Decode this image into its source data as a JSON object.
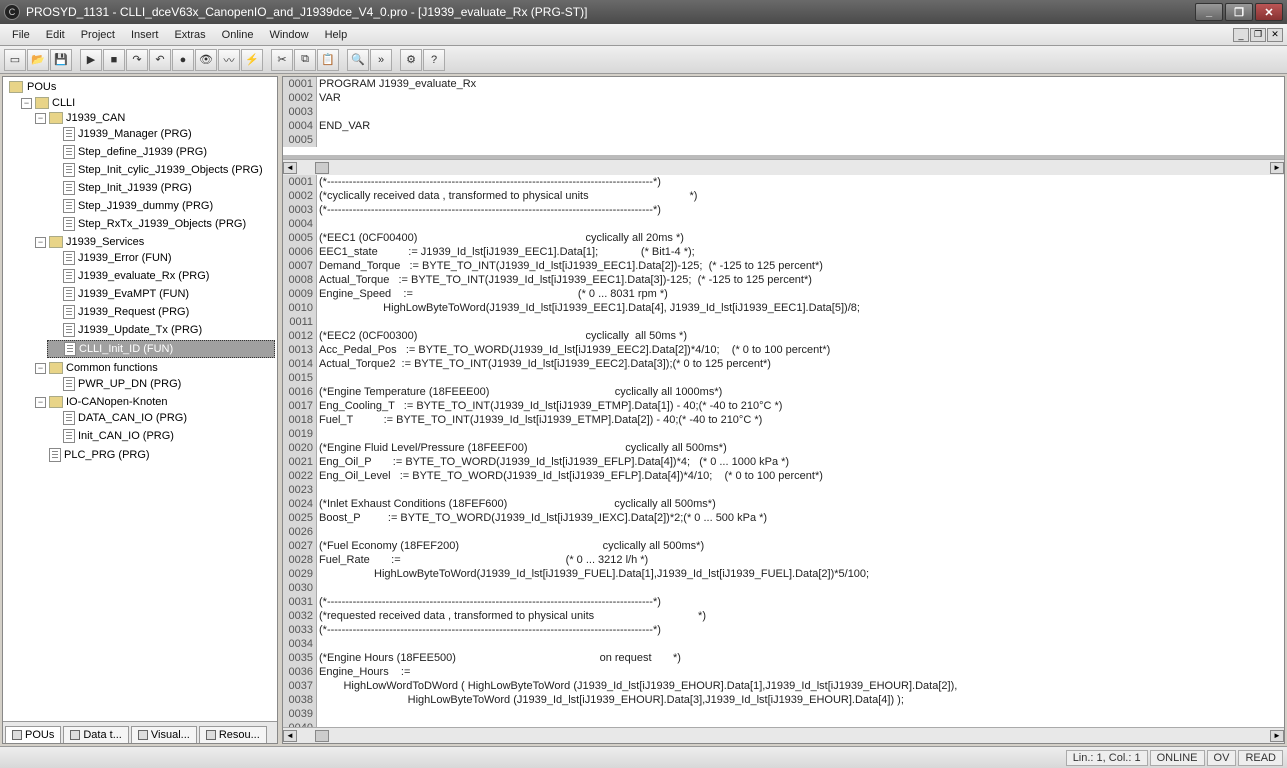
{
  "title": "PROSYD_1131 - CLLI_dceV63x_CanopenIO_and_J1939dce_V4_0.pro - [J1939_evaluate_Rx (PRG-ST)]",
  "menu": [
    "File",
    "Edit",
    "Project",
    "Insert",
    "Extras",
    "Online",
    "Window",
    "Help"
  ],
  "toolbar_icons": [
    "new",
    "open",
    "save",
    "|",
    "run",
    "stop",
    "step",
    "over",
    "bp",
    "watch",
    "trace",
    "force",
    "|",
    "cut",
    "copy",
    "paste",
    "|",
    "find",
    "next",
    "|",
    "cfg",
    "help"
  ],
  "tree": {
    "root": "POUs",
    "nodes": [
      {
        "label": "CLLI",
        "folder": true,
        "children": [
          {
            "label": "J1939_CAN",
            "folder": true,
            "children": [
              {
                "label": "J1939_Manager (PRG)"
              },
              {
                "label": "Step_define_J1939 (PRG)"
              },
              {
                "label": "Step_Init_cylic_J1939_Objects (PRG)"
              },
              {
                "label": "Step_Init_J1939 (PRG)"
              },
              {
                "label": "Step_J1939_dummy (PRG)"
              },
              {
                "label": "Step_RxTx_J1939_Objects (PRG)"
              }
            ]
          },
          {
            "label": "J1939_Services",
            "folder": true,
            "children": [
              {
                "label": "J1939_Error (FUN)"
              },
              {
                "label": "J1939_evaluate_Rx (PRG)"
              },
              {
                "label": "J1939_EvaMPT (FUN)"
              },
              {
                "label": "J1939_Request (PRG)"
              },
              {
                "label": "J1939_Update_Tx (PRG)"
              },
              {
                "label": "CLLI_Init_ID (FUN)",
                "selected": true
              }
            ]
          },
          {
            "label": "Common functions",
            "folder": true,
            "children": [
              {
                "label": "PWR_UP_DN (PRG)"
              }
            ]
          },
          {
            "label": "IO-CANopen-Knoten",
            "folder": true,
            "children": [
              {
                "label": "DATA_CAN_IO (PRG)"
              },
              {
                "label": "Init_CAN_IO (PRG)"
              }
            ]
          },
          {
            "label": "PLC_PRG (PRG)"
          }
        ]
      }
    ]
  },
  "tabs": [
    {
      "label": "POUs",
      "active": true
    },
    {
      "label": "Data t..."
    },
    {
      "label": "Visual..."
    },
    {
      "label": "Resou..."
    }
  ],
  "decl": [
    {
      "n": "0001",
      "t": "PROGRAM J1939_evaluate_Rx"
    },
    {
      "n": "0002",
      "t": "VAR"
    },
    {
      "n": "0003",
      "t": ""
    },
    {
      "n": "0004",
      "t": "END_VAR"
    },
    {
      "n": "0005",
      "t": ""
    }
  ],
  "body": [
    {
      "n": "0001",
      "t": "(*-----------------------------------------------------------------------------------------*)"
    },
    {
      "n": "0002",
      "t": "(*cyclically received data , transformed to physical units                                 *)"
    },
    {
      "n": "0003",
      "t": "(*-----------------------------------------------------------------------------------------*)"
    },
    {
      "n": "0004",
      "t": ""
    },
    {
      "n": "0005",
      "t": "(*EEC1 (0CF00400)                                                       cyclically all 20ms *)"
    },
    {
      "n": "0006",
      "t": "EEC1_state          := J1939_Id_lst[iJ1939_EEC1].Data[1];              (* Bit1-4 *);"
    },
    {
      "n": "0007",
      "t": "Demand_Torque   := BYTE_TO_INT(J1939_Id_lst[iJ1939_EEC1].Data[2])-125;  (* -125 to 125 percent*)"
    },
    {
      "n": "0008",
      "t": "Actual_Torque   := BYTE_TO_INT(J1939_Id_lst[iJ1939_EEC1].Data[3])-125;  (* -125 to 125 percent*)"
    },
    {
      "n": "0009",
      "t": "Engine_Speed    :=                                                      (* 0 ... 8031 rpm *)"
    },
    {
      "n": "0010",
      "t": "                     HighLowByteToWord(J1939_Id_lst[iJ1939_EEC1].Data[4], J1939_Id_lst[iJ1939_EEC1].Data[5])/8;"
    },
    {
      "n": "0011",
      "t": ""
    },
    {
      "n": "0012",
      "t": "(*EEC2 (0CF00300)                                                       cyclically  all 50ms *)"
    },
    {
      "n": "0013",
      "t": "Acc_Pedal_Pos   := BYTE_TO_WORD(J1939_Id_lst[iJ1939_EEC2].Data[2])*4/10;    (* 0 to 100 percent*)"
    },
    {
      "n": "0014",
      "t": "Actual_Torque2  := BYTE_TO_INT(J1939_Id_lst[iJ1939_EEC2].Data[3]);(* 0 to 125 percent*)"
    },
    {
      "n": "0015",
      "t": ""
    },
    {
      "n": "0016",
      "t": "(*Engine Temperature (18FEEE00)                                         cyclically all 1000ms*)"
    },
    {
      "n": "0017",
      "t": "Eng_Cooling_T   := BYTE_TO_INT(J1939_Id_lst[iJ1939_ETMP].Data[1]) - 40;(* -40 to 210°C *)"
    },
    {
      "n": "0018",
      "t": "Fuel_T          := BYTE_TO_INT(J1939_Id_lst[iJ1939_ETMP].Data[2]) - 40;(* -40 to 210°C *)"
    },
    {
      "n": "0019",
      "t": ""
    },
    {
      "n": "0020",
      "t": "(*Engine Fluid Level/Pressure (18FEEF00)                                cyclically all 500ms*)"
    },
    {
      "n": "0021",
      "t": "Eng_Oil_P       := BYTE_TO_WORD(J1939_Id_lst[iJ1939_EFLP].Data[4])*4;   (* 0 ... 1000 kPa *)"
    },
    {
      "n": "0022",
      "t": "Eng_Oil_Level   := BYTE_TO_WORD(J1939_Id_lst[iJ1939_EFLP].Data[4])*4/10;    (* 0 to 100 percent*)"
    },
    {
      "n": "0023",
      "t": ""
    },
    {
      "n": "0024",
      "t": "(*Inlet Exhaust Conditions (18FEF600)                                   cyclically all 500ms*)"
    },
    {
      "n": "0025",
      "t": "Boost_P         := BYTE_TO_WORD(J1939_Id_lst[iJ1939_IEXC].Data[2])*2;(* 0 ... 500 kPa *)"
    },
    {
      "n": "0026",
      "t": ""
    },
    {
      "n": "0027",
      "t": "(*Fuel Economy (18FEF200)                                               cyclically all 500ms*)"
    },
    {
      "n": "0028",
      "t": "Fuel_Rate       :=                                                      (* 0 ... 3212 l/h *)"
    },
    {
      "n": "0029",
      "t": "                  HighLowByteToWord(J1939_Id_lst[iJ1939_FUEL].Data[1],J1939_Id_lst[iJ1939_FUEL].Data[2])*5/100;"
    },
    {
      "n": "0030",
      "t": ""
    },
    {
      "n": "0031",
      "t": "(*-----------------------------------------------------------------------------------------*)"
    },
    {
      "n": "0032",
      "t": "(*requested received data , transformed to physical units                                  *)"
    },
    {
      "n": "0033",
      "t": "(*-----------------------------------------------------------------------------------------*)"
    },
    {
      "n": "0034",
      "t": ""
    },
    {
      "n": "0035",
      "t": "(*Engine Hours (18FEE500)                                               on request       *)"
    },
    {
      "n": "0036",
      "t": "Engine_Hours    :="
    },
    {
      "n": "0037",
      "t": "        HighLowWordToDWord ( HighLowByteToWord (J1939_Id_lst[iJ1939_EHOUR].Data[1],J1939_Id_lst[iJ1939_EHOUR].Data[2]),"
    },
    {
      "n": "0038",
      "t": "                             HighLowByteToWord (J1939_Id_lst[iJ1939_EHOUR].Data[3],J1939_Id_lst[iJ1939_EHOUR].Data[4]) );"
    },
    {
      "n": "0039",
      "t": ""
    },
    {
      "n": "0040",
      "t": ""
    }
  ],
  "status": {
    "pos": "Lin.: 1, Col.: 1",
    "online": "ONLINE",
    "ov": "OV",
    "read": "READ"
  }
}
